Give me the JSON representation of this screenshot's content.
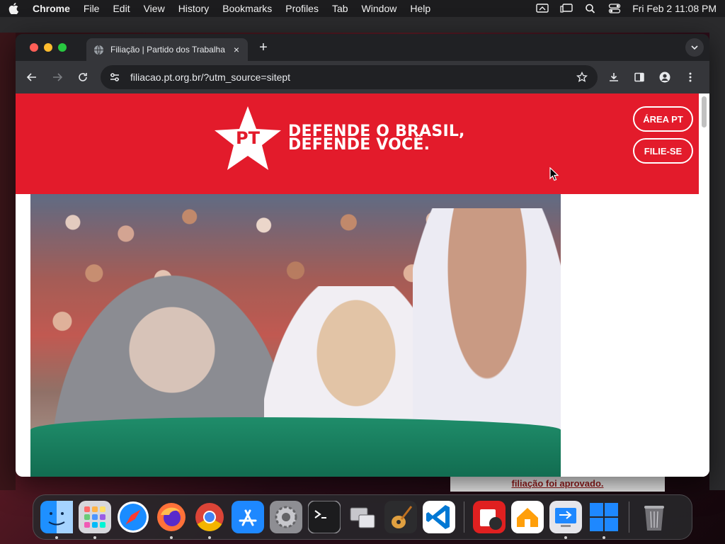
{
  "menubar": {
    "app_name": "Chrome",
    "items": [
      "File",
      "Edit",
      "View",
      "History",
      "Bookmarks",
      "Profiles",
      "Tab",
      "Window",
      "Help"
    ],
    "clock": "Fri Feb 2  11:08 PM"
  },
  "browser": {
    "tab_title": "Filiação | Partido dos Trabalha",
    "tab_close": "×",
    "new_tab": "+",
    "url_host": "filiacao.pt.org.br",
    "url_path": "/?utm_source=sitept"
  },
  "site": {
    "logo_text": "PT",
    "slogan_line1": "DEFENDE O BRASIL,",
    "slogan_line2": "DEFENDE VOCÊ.",
    "area_button": "ÁREA PT",
    "join_button": "FILIE-SE",
    "brand_color": "#e31b2b"
  },
  "background_window": {
    "link_text": "filiação foi aprovado."
  },
  "dock": {
    "apps": [
      "Finder",
      "Launchpad",
      "Safari",
      "Firefox",
      "Chrome",
      "App Store",
      "System Settings",
      "Terminal",
      "Migration Assistant",
      "GarageBand",
      "Visual Studio Code",
      "Photo Booth",
      "Home",
      "Remote Desktop",
      "Windows App",
      "Trash"
    ]
  }
}
